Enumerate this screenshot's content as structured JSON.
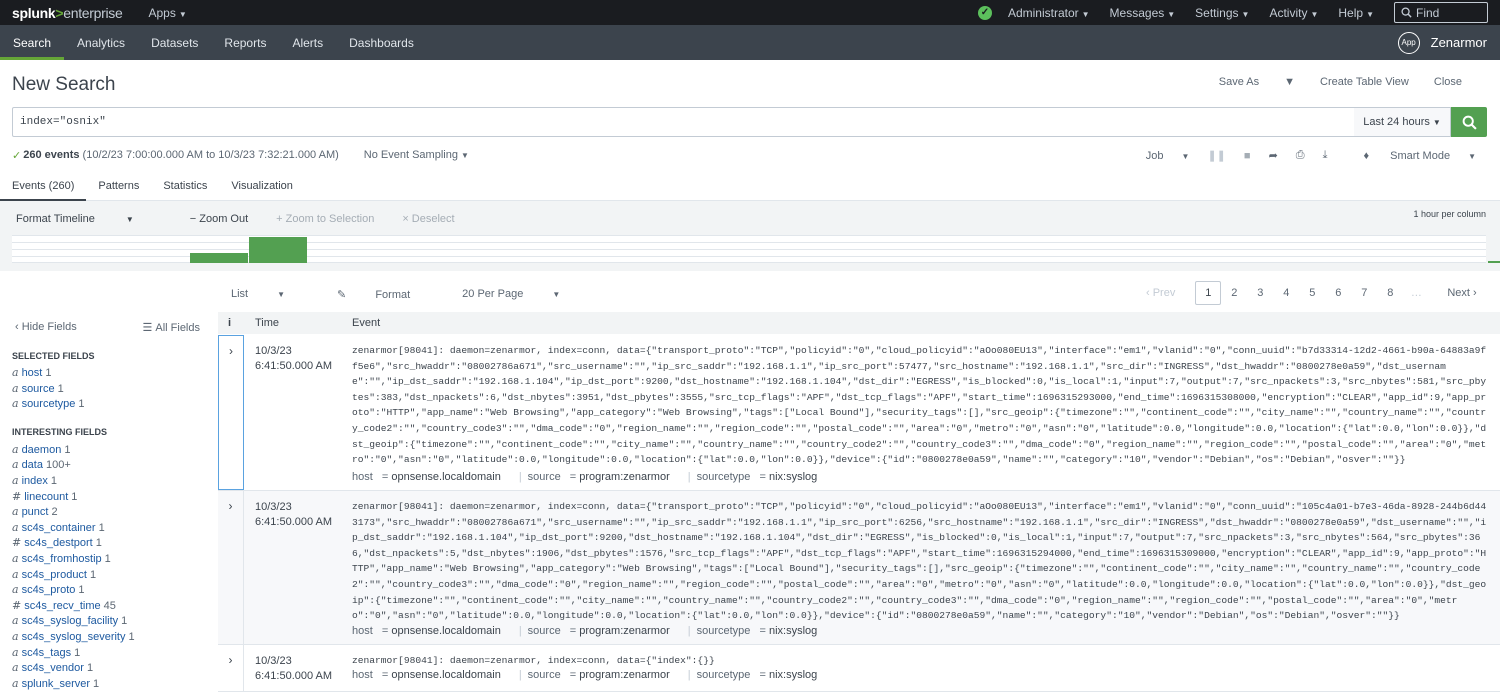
{
  "topbar": {
    "logo_main": "splunk",
    "logo_gt": ">",
    "logo_sub": "enterprise",
    "apps": "Apps",
    "menus": [
      "Administrator",
      "Messages",
      "Settings",
      "Activity",
      "Help"
    ],
    "find_placeholder": "Find",
    "status_color": "#5cc05c"
  },
  "appbar": {
    "nav": [
      "Search",
      "Analytics",
      "Datasets",
      "Reports",
      "Alerts",
      "Dashboards"
    ],
    "active": "Search",
    "app_badge": "App",
    "app_name": "Zenarmor"
  },
  "page": {
    "title": "New Search",
    "actions": [
      "Save As",
      "Create Table View",
      "Close"
    ]
  },
  "search": {
    "query": "index=\"osnix\"",
    "time_range": "Last 24 hours"
  },
  "status": {
    "count": "260 events",
    "range": "(10/2/23 7:00:00.000 AM to 10/3/23 7:32:21.000 AM)",
    "sampling": "No Event Sampling",
    "job": "Job",
    "mode": "Smart Mode"
  },
  "tabs": [
    "Events (260)",
    "Patterns",
    "Statistics",
    "Visualization"
  ],
  "timeline": {
    "tools": [
      "Format Timeline",
      "− Zoom Out",
      "+ Zoom to Selection",
      "× Deselect"
    ],
    "scale": "1 hour per column",
    "bars": [
      0,
      0,
      0.4,
      1.0,
      0,
      0,
      0,
      0,
      0,
      0,
      0,
      0,
      0,
      0,
      0,
      0,
      0,
      0,
      0,
      0,
      0,
      0,
      0,
      0,
      0.08,
      0
    ],
    "bar_color": "#53a051"
  },
  "list": {
    "tools": [
      "List",
      "Format",
      "20 Per Page"
    ],
    "prev": "‹ Prev",
    "pages": [
      "1",
      "2",
      "3",
      "4",
      "5",
      "6",
      "7",
      "8"
    ],
    "ellipsis": "…",
    "next": "Next ›"
  },
  "sidebar": {
    "hide": "‹ Hide Fields",
    "all": "All Fields",
    "selected_label": "SELECTED FIELDS",
    "selected": [
      {
        "type": "a",
        "name": "host",
        "count": "1"
      },
      {
        "type": "a",
        "name": "source",
        "count": "1"
      },
      {
        "type": "a",
        "name": "sourcetype",
        "count": "1"
      }
    ],
    "interesting_label": "INTERESTING FIELDS",
    "interesting": [
      {
        "type": "a",
        "name": "daemon",
        "count": "1"
      },
      {
        "type": "a",
        "name": "data",
        "count": "100+"
      },
      {
        "type": "a",
        "name": "index",
        "count": "1"
      },
      {
        "type": "#",
        "name": "linecount",
        "count": "1"
      },
      {
        "type": "a",
        "name": "punct",
        "count": "2"
      },
      {
        "type": "a",
        "name": "sc4s_container",
        "count": "1"
      },
      {
        "type": "#",
        "name": "sc4s_destport",
        "count": "1"
      },
      {
        "type": "a",
        "name": "sc4s_fromhostip",
        "count": "1"
      },
      {
        "type": "a",
        "name": "sc4s_product",
        "count": "1"
      },
      {
        "type": "a",
        "name": "sc4s_proto",
        "count": "1"
      },
      {
        "type": "#",
        "name": "sc4s_recv_time",
        "count": "45"
      },
      {
        "type": "a",
        "name": "sc4s_syslog_facility",
        "count": "1"
      },
      {
        "type": "a",
        "name": "sc4s_syslog_severity",
        "count": "1"
      },
      {
        "type": "a",
        "name": "sc4s_tags",
        "count": "1"
      },
      {
        "type": "a",
        "name": "sc4s_vendor",
        "count": "1"
      },
      {
        "type": "a",
        "name": "splunk_server",
        "count": "1"
      }
    ]
  },
  "grid": {
    "headers": [
      "i",
      "Time",
      "Event"
    ],
    "events": [
      {
        "date": "10/3/23",
        "time": "6:41:50.000 AM",
        "text": "zenarmor[98041]: daemon=zenarmor, index=conn, data={\"transport_proto\":\"TCP\",\"policyid\":\"0\",\"cloud_policyid\":\"aOo080EU13\",\"interface\":\"em1\",\"vlanid\":\"0\",\"conn_uuid\":\"b7d33314-12d2-4661-b90a-64883a9ff5e6\",\"src_hwaddr\":\"08002786a671\",\"src_username\":\"\",\"ip_src_saddr\":\"192.168.1.1\",\"ip_src_port\":57477,\"src_hostname\":\"192.168.1.1\",\"src_dir\":\"INGRESS\",\"dst_hwaddr\":\"0800278e0a59\",\"dst_username\":\"\",\"ip_dst_saddr\":\"192.168.1.104\",\"ip_dst_port\":9200,\"dst_hostname\":\"192.168.1.104\",\"dst_dir\":\"EGRESS\",\"is_blocked\":0,\"is_local\":1,\"input\":7,\"output\":7,\"src_npackets\":3,\"src_nbytes\":581,\"src_pbytes\":383,\"dst_npackets\":6,\"dst_nbytes\":3951,\"dst_pbytes\":3555,\"src_tcp_flags\":\"APF\",\"dst_tcp_flags\":\"APF\",\"start_time\":1696315293000,\"end_time\":1696315308000,\"encryption\":\"CLEAR\",\"app_id\":9,\"app_proto\":\"HTTP\",\"app_name\":\"Web Browsing\",\"app_category\":\"Web Browsing\",\"tags\":[\"Local Bound\"],\"security_tags\":[],\"src_geoip\":{\"timezone\":\"\",\"continent_code\":\"\",\"city_name\":\"\",\"country_name\":\"\",\"country_code2\":\"\",\"country_code3\":\"\",\"dma_code\":\"0\",\"region_name\":\"\",\"region_code\":\"\",\"postal_code\":\"\",\"area\":\"0\",\"metro\":\"0\",\"asn\":\"0\",\"latitude\":0.0,\"longitude\":0.0,\"location\":{\"lat\":0.0,\"lon\":0.0}},\"dst_geoip\":{\"timezone\":\"\",\"continent_code\":\"\",\"city_name\":\"\",\"country_name\":\"\",\"country_code2\":\"\",\"country_code3\":\"\",\"dma_code\":\"0\",\"region_name\":\"\",\"region_code\":\"\",\"postal_code\":\"\",\"area\":\"0\",\"metro\":\"0\",\"asn\":\"0\",\"latitude\":0.0,\"longitude\":0.0,\"location\":{\"lat\":0.0,\"lon\":0.0}},\"device\":{\"id\":\"0800278e0a59\",\"name\":\"\",\"category\":\"10\",\"vendor\":\"Debian\",\"os\":\"Debian\",\"osver\":\"\"}}",
        "host": "opnsense.localdomain",
        "source": "program:zenarmor",
        "sourcetype": "nix:syslog"
      },
      {
        "date": "10/3/23",
        "time": "6:41:50.000 AM",
        "text": "zenarmor[98041]: daemon=zenarmor, index=conn, data={\"transport_proto\":\"TCP\",\"policyid\":\"0\",\"cloud_policyid\":\"aOo080EU13\",\"interface\":\"em1\",\"vlanid\":\"0\",\"conn_uuid\":\"105c4a01-b7e3-46da-8928-244b6d443173\",\"src_hwaddr\":\"08002786a671\",\"src_username\":\"\",\"ip_src_saddr\":\"192.168.1.1\",\"ip_src_port\":6256,\"src_hostname\":\"192.168.1.1\",\"src_dir\":\"INGRESS\",\"dst_hwaddr\":\"0800278e0a59\",\"dst_username\":\"\",\"ip_dst_saddr\":\"192.168.1.104\",\"ip_dst_port\":9200,\"dst_hostname\":\"192.168.1.104\",\"dst_dir\":\"EGRESS\",\"is_blocked\":0,\"is_local\":1,\"input\":7,\"output\":7,\"src_npackets\":3,\"src_nbytes\":564,\"src_pbytes\":366,\"dst_npackets\":5,\"dst_nbytes\":1906,\"dst_pbytes\":1576,\"src_tcp_flags\":\"APF\",\"dst_tcp_flags\":\"APF\",\"start_time\":1696315294000,\"end_time\":1696315309000,\"encryption\":\"CLEAR\",\"app_id\":9,\"app_proto\":\"HTTP\",\"app_name\":\"Web Browsing\",\"app_category\":\"Web Browsing\",\"tags\":[\"Local Bound\"],\"security_tags\":[],\"src_geoip\":{\"timezone\":\"\",\"continent_code\":\"\",\"city_name\":\"\",\"country_name\":\"\",\"country_code2\":\"\",\"country_code3\":\"\",\"dma_code\":\"0\",\"region_name\":\"\",\"region_code\":\"\",\"postal_code\":\"\",\"area\":\"0\",\"metro\":\"0\",\"asn\":\"0\",\"latitude\":0.0,\"longitude\":0.0,\"location\":{\"lat\":0.0,\"lon\":0.0}},\"dst_geoip\":{\"timezone\":\"\",\"continent_code\":\"\",\"city_name\":\"\",\"country_name\":\"\",\"country_code2\":\"\",\"country_code3\":\"\",\"dma_code\":\"0\",\"region_name\":\"\",\"region_code\":\"\",\"postal_code\":\"\",\"area\":\"0\",\"metro\":\"0\",\"asn\":\"0\",\"latitude\":0.0,\"longitude\":0.0,\"location\":{\"lat\":0.0,\"lon\":0.0}},\"device\":{\"id\":\"0800278e0a59\",\"name\":\"\",\"category\":\"10\",\"vendor\":\"Debian\",\"os\":\"Debian\",\"osver\":\"\"}}",
        "host": "opnsense.localdomain",
        "source": "program:zenarmor",
        "sourcetype": "nix:syslog"
      },
      {
        "date": "10/3/23",
        "time": "6:41:50.000 AM",
        "text": "zenarmor[98041]: daemon=zenarmor, index=conn, data={\"index\":{}}",
        "host": "opnsense.localdomain",
        "source": "program:zenarmor",
        "sourcetype": "nix:syslog"
      }
    ]
  },
  "meta_labels": {
    "host": "host",
    "source": "source",
    "sourcetype": "sourcetype"
  }
}
